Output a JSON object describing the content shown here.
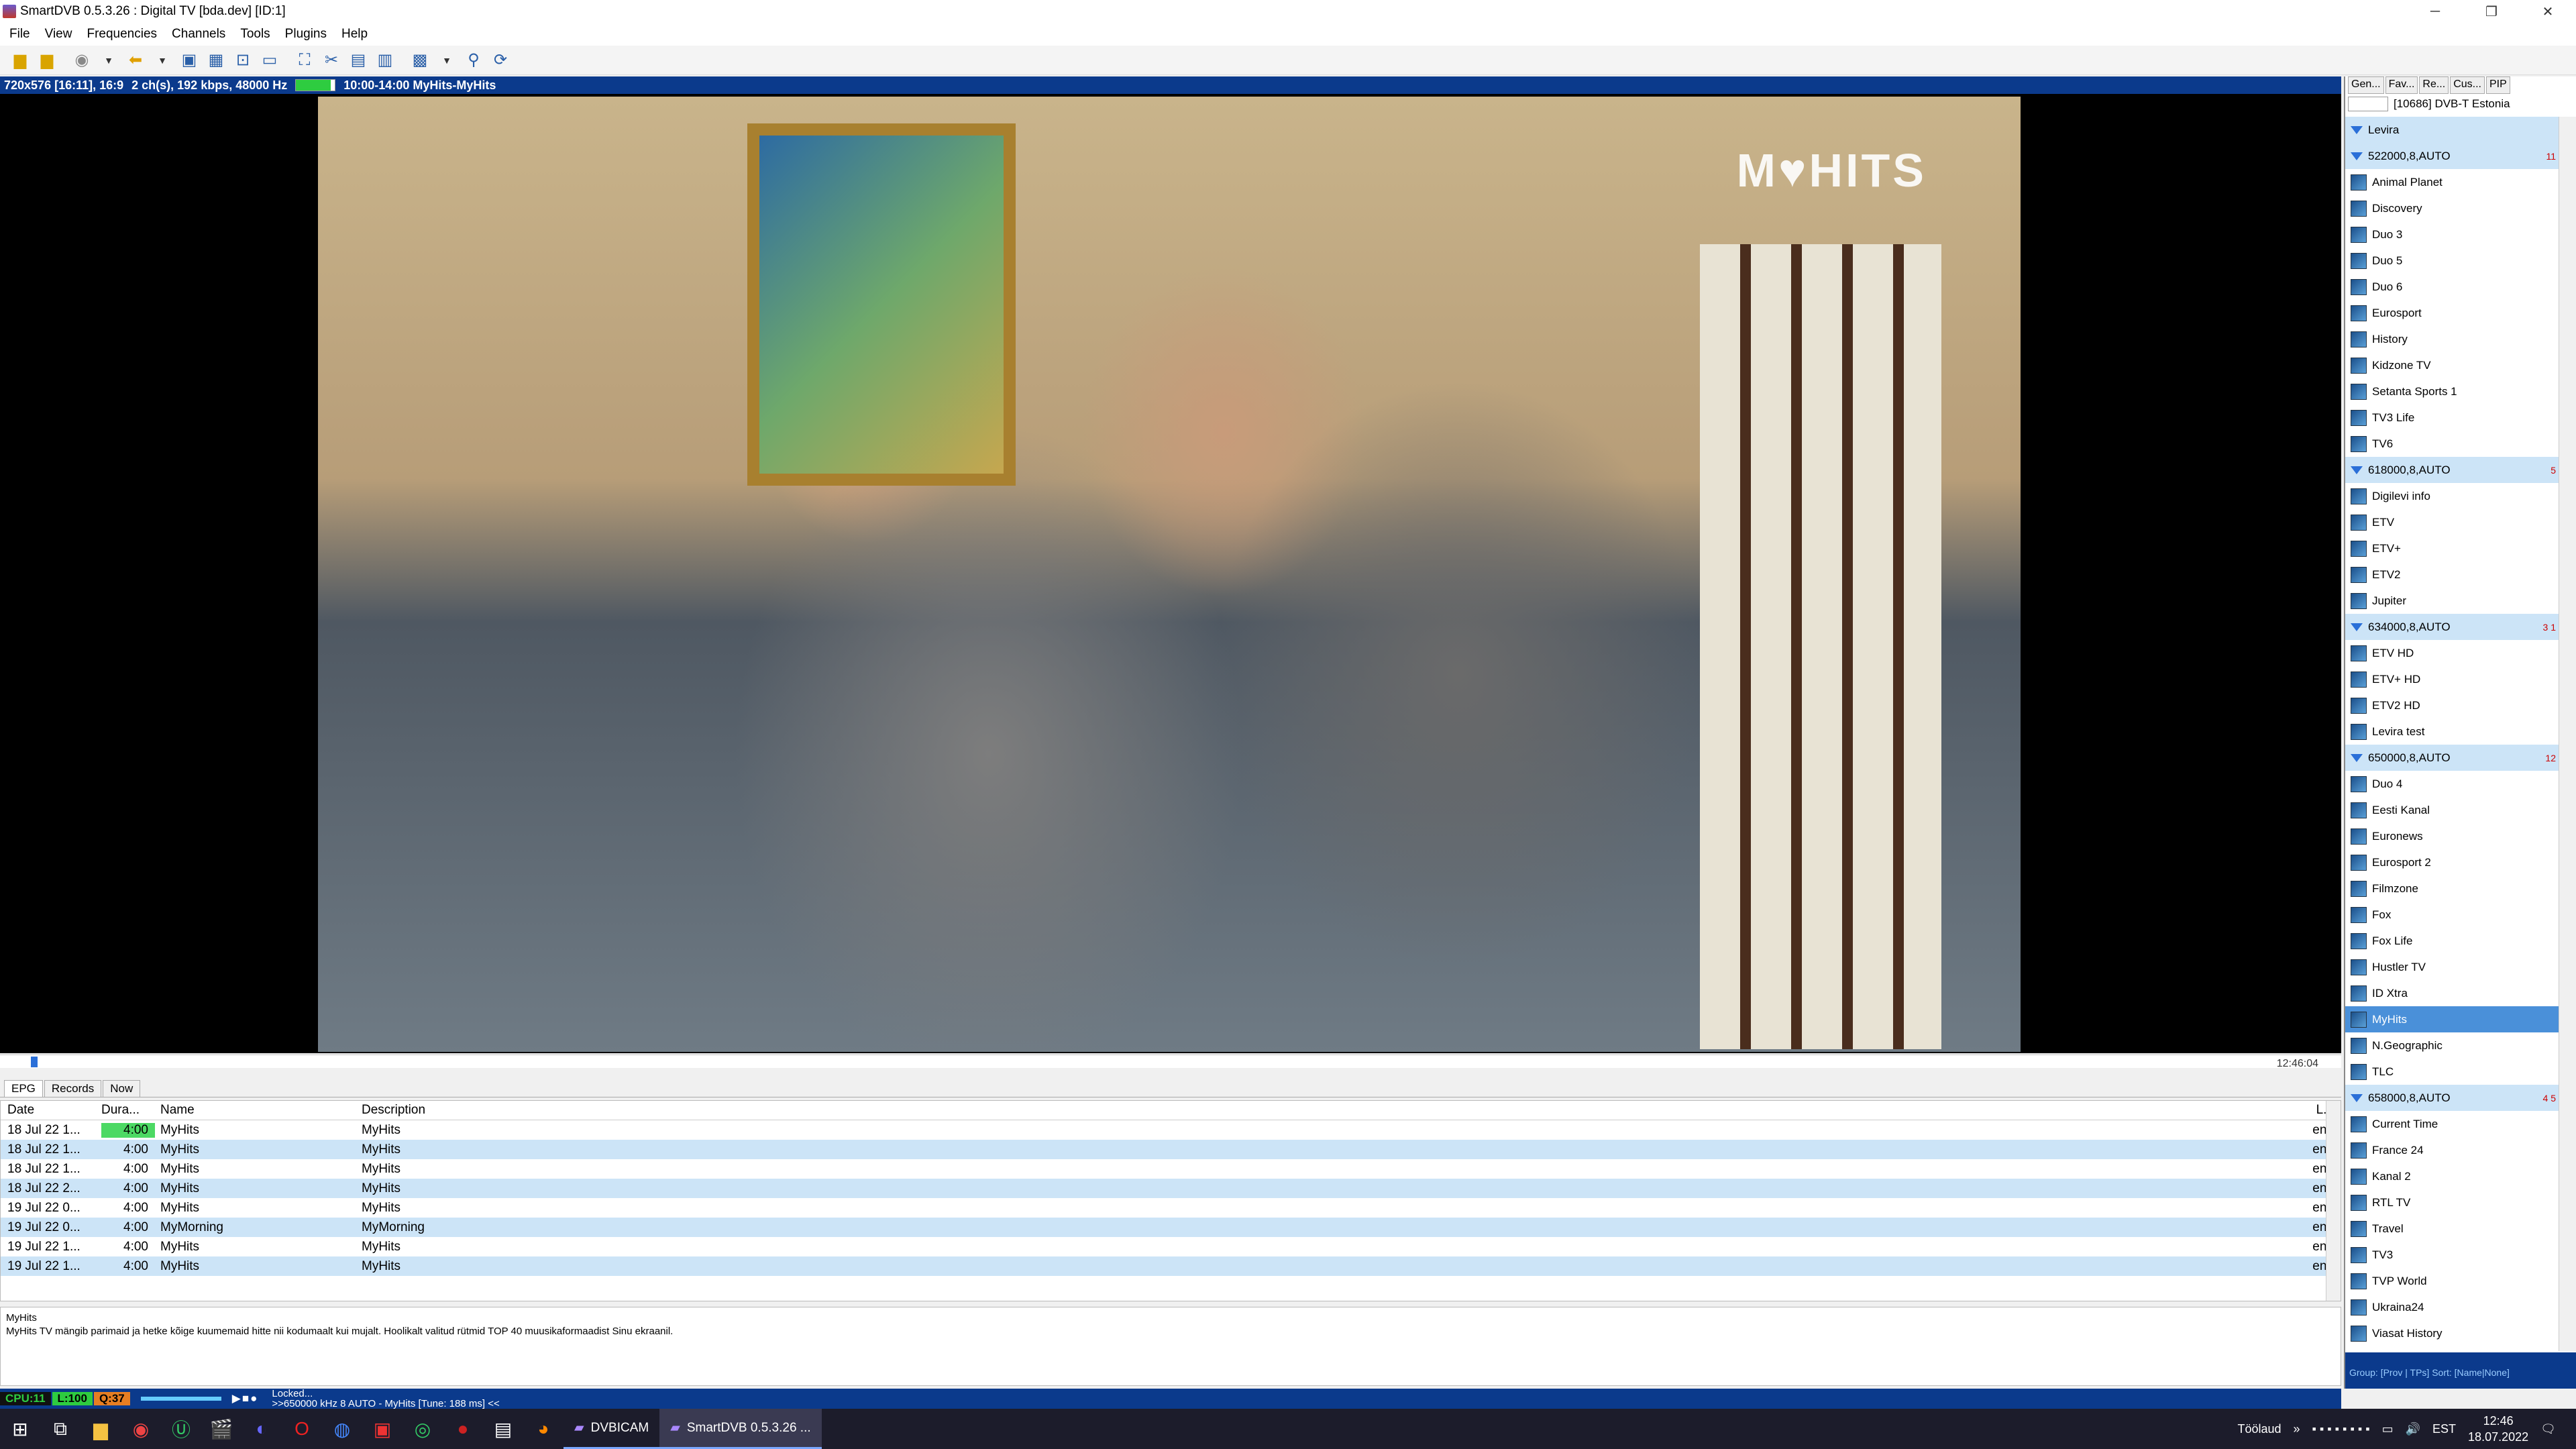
{
  "window": {
    "title": "SmartDVB 0.5.3.26 : Digital TV [bda.dev]  [ID:1]"
  },
  "menu": [
    "File",
    "View",
    "Frequencies",
    "Channels",
    "Tools",
    "Plugins",
    "Help"
  ],
  "infobar": {
    "video": "720x576 [16:11], 16:9",
    "audio": "2 ch(s), 192 kbps, 48000 Hz",
    "program": "10:00-14:00 MyHits-MyHits"
  },
  "video": {
    "logo": "M♥HITS"
  },
  "timeline": {
    "time": "12:46:04"
  },
  "epg_tabs": [
    "EPG",
    "Records",
    "Now"
  ],
  "epg_lang": "en",
  "epg": {
    "headers": [
      "Date",
      "Dura...",
      "Name",
      "Description",
      "L..."
    ],
    "rows": [
      {
        "date": "18 Jul 22 1...",
        "dur": "4:00",
        "name": "MyHits",
        "desc": "MyHits",
        "lang": "eng"
      },
      {
        "date": "18 Jul 22 1...",
        "dur": "4:00",
        "name": "MyHits",
        "desc": "MyHits",
        "lang": "eng"
      },
      {
        "date": "18 Jul 22 1...",
        "dur": "4:00",
        "name": "MyHits",
        "desc": "MyHits",
        "lang": "eng"
      },
      {
        "date": "18 Jul 22 2...",
        "dur": "4:00",
        "name": "MyHits",
        "desc": "MyHits",
        "lang": "eng"
      },
      {
        "date": "19 Jul 22 0...",
        "dur": "4:00",
        "name": "MyHits",
        "desc": "MyHits",
        "lang": "eng"
      },
      {
        "date": "19 Jul 22 0...",
        "dur": "4:00",
        "name": "MyMorning",
        "desc": "MyMorning",
        "lang": "eng"
      },
      {
        "date": "19 Jul 22 1...",
        "dur": "4:00",
        "name": "MyHits",
        "desc": "MyHits",
        "lang": "eng"
      },
      {
        "date": "19 Jul 22 1...",
        "dur": "4:00",
        "name": "MyHits",
        "desc": "MyHits",
        "lang": "eng"
      }
    ]
  },
  "description": {
    "title": "MyHits",
    "text": "MyHits TV mängib parimaid ja hetke kõige kuumemaid hitte nii kodumaalt kui mujalt. Hoolikalt valitud rütmid TOP 40 muusikaformaadist Sinu ekraanil."
  },
  "status": {
    "cpu": "CPU:11",
    "level": "L:100",
    "quality": "Q:37",
    "locked": "Locked...",
    "message": ">>650000 kHz 8 AUTO - MyHits [Tune: 188 ms] <<"
  },
  "right_panel": {
    "tabs": [
      "Gen...",
      "Fav...",
      "Re...",
      "Cus...",
      "PIP"
    ],
    "network": "[10686] DVB-T Estonia",
    "channels": [
      {
        "label": "Levira",
        "type": "group"
      },
      {
        "label": "522000,8,AUTO",
        "type": "group",
        "badge": "11"
      },
      {
        "label": "Animal Planet",
        "type": "ch"
      },
      {
        "label": "Discovery",
        "type": "ch"
      },
      {
        "label": "Duo 3",
        "type": "ch"
      },
      {
        "label": "Duo 5",
        "type": "ch"
      },
      {
        "label": "Duo 6",
        "type": "ch"
      },
      {
        "label": "Eurosport",
        "type": "ch"
      },
      {
        "label": "History",
        "type": "ch"
      },
      {
        "label": "Kidzone TV",
        "type": "ch"
      },
      {
        "label": "Setanta Sports 1",
        "type": "ch"
      },
      {
        "label": "TV3 Life",
        "type": "ch"
      },
      {
        "label": "TV6",
        "type": "ch"
      },
      {
        "label": "618000,8,AUTO",
        "type": "group",
        "badge": "5"
      },
      {
        "label": "Digilevi info",
        "type": "ch"
      },
      {
        "label": "ETV",
        "type": "ch"
      },
      {
        "label": "ETV+",
        "type": "ch"
      },
      {
        "label": "ETV2",
        "type": "ch"
      },
      {
        "label": "Jupiter",
        "type": "ch"
      },
      {
        "label": "634000,8,AUTO",
        "type": "group",
        "badge": "3 1"
      },
      {
        "label": "ETV HD",
        "type": "ch"
      },
      {
        "label": "ETV+ HD",
        "type": "ch"
      },
      {
        "label": "ETV2 HD",
        "type": "ch"
      },
      {
        "label": "Levira test",
        "type": "ch"
      },
      {
        "label": "650000,8,AUTO",
        "type": "group",
        "badge": "12"
      },
      {
        "label": "Duo 4",
        "type": "ch"
      },
      {
        "label": "Eesti Kanal",
        "type": "ch"
      },
      {
        "label": "Euronews",
        "type": "ch"
      },
      {
        "label": "Eurosport 2",
        "type": "ch"
      },
      {
        "label": "Filmzone",
        "type": "ch"
      },
      {
        "label": "Fox",
        "type": "ch"
      },
      {
        "label": "Fox Life",
        "type": "ch"
      },
      {
        "label": "Hustler TV",
        "type": "ch"
      },
      {
        "label": "ID Xtra",
        "type": "ch"
      },
      {
        "label": "MyHits",
        "type": "sel"
      },
      {
        "label": "N.Geographic",
        "type": "ch"
      },
      {
        "label": "TLC",
        "type": "ch"
      },
      {
        "label": "658000,8,AUTO",
        "type": "group",
        "badge": "4 5"
      },
      {
        "label": "Current Time",
        "type": "ch"
      },
      {
        "label": "France 24",
        "type": "ch"
      },
      {
        "label": "Kanal 2",
        "type": "ch"
      },
      {
        "label": "RTL TV",
        "type": "ch"
      },
      {
        "label": "Travel",
        "type": "ch"
      },
      {
        "label": "TV3",
        "type": "ch"
      },
      {
        "label": "TVP World",
        "type": "ch"
      },
      {
        "label": "Ukraina24",
        "type": "ch"
      },
      {
        "label": "Viasat History",
        "type": "ch"
      }
    ],
    "footer": "Group: [Prov | TPs] Sort: [Name|None]"
  },
  "taskbar": {
    "tasks": [
      "DVBICAM",
      "SmartDVB 0.5.3.26 ..."
    ],
    "tray_label": "Töölaud",
    "lang": "EST",
    "time": "12:46",
    "date": "18.07.2022"
  }
}
